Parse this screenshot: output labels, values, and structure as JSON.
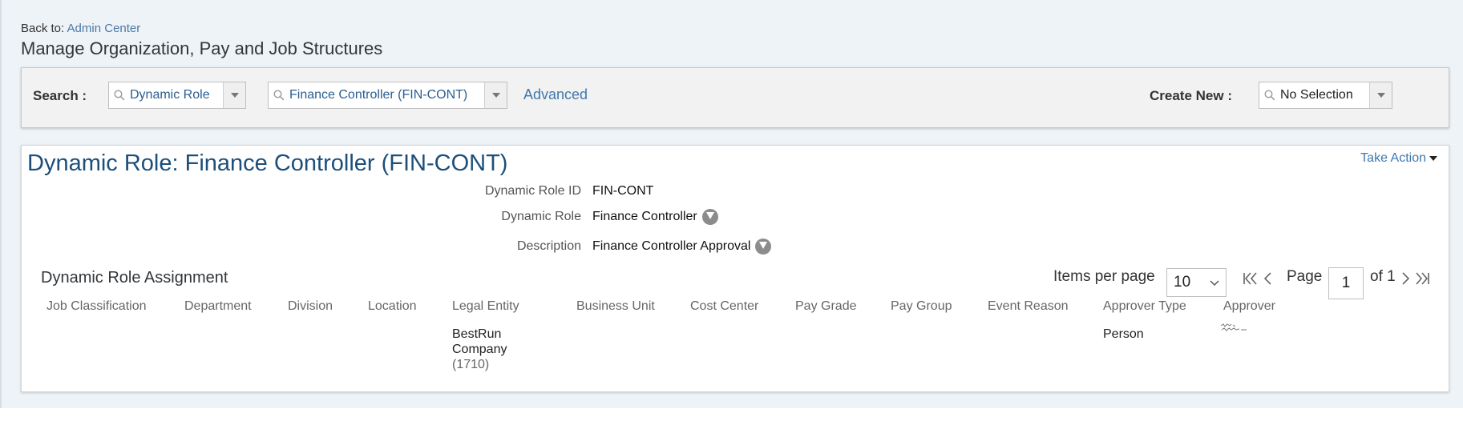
{
  "header": {
    "back_prefix": "Back to:",
    "back_link": "Admin Center",
    "page_title": "Manage Organization, Pay and Job Structures"
  },
  "search": {
    "label": "Search :",
    "object_type": "Dynamic Role",
    "object_value": "Finance Controller (FIN-CONT)",
    "advanced_link": "Advanced",
    "create_new_label": "Create New :",
    "create_new_value": "No Selection"
  },
  "record": {
    "title": "Dynamic Role: Finance Controller (FIN-CONT)",
    "take_action": "Take Action",
    "fields": [
      {
        "label": "Dynamic Role ID",
        "value": "FIN-CONT"
      },
      {
        "label": "Dynamic Role",
        "value": "Finance Controller"
      },
      {
        "label": "Description",
        "value": "Finance Controller Approval"
      }
    ]
  },
  "assignment": {
    "section_title": "Dynamic Role Assignment",
    "items_per_page_label": "Items per page",
    "items_per_page": "10",
    "page_label": "Page",
    "page_number": "1",
    "of_label": "of 1",
    "columns": [
      "Job Classification",
      "Department",
      "Division",
      "Location",
      "Legal Entity",
      "Business Unit",
      "Cost Center",
      "Pay Grade",
      "Pay Group",
      "Event Reason",
      "Approver Type",
      "Approver"
    ],
    "rows": [
      {
        "legal_entity_name_1": "BestRun",
        "legal_entity_name_2": "Company",
        "legal_entity_code": "(1710)",
        "approver_type": "Person"
      }
    ]
  },
  "icons": {
    "search_icon": "search-icon",
    "dropdown_icon": "chevron-down-icon",
    "info_icon": "info-icon"
  },
  "colors": {
    "link": "#3f78ad",
    "title": "#1d4f7a",
    "page_bg": "#eef3f7"
  }
}
